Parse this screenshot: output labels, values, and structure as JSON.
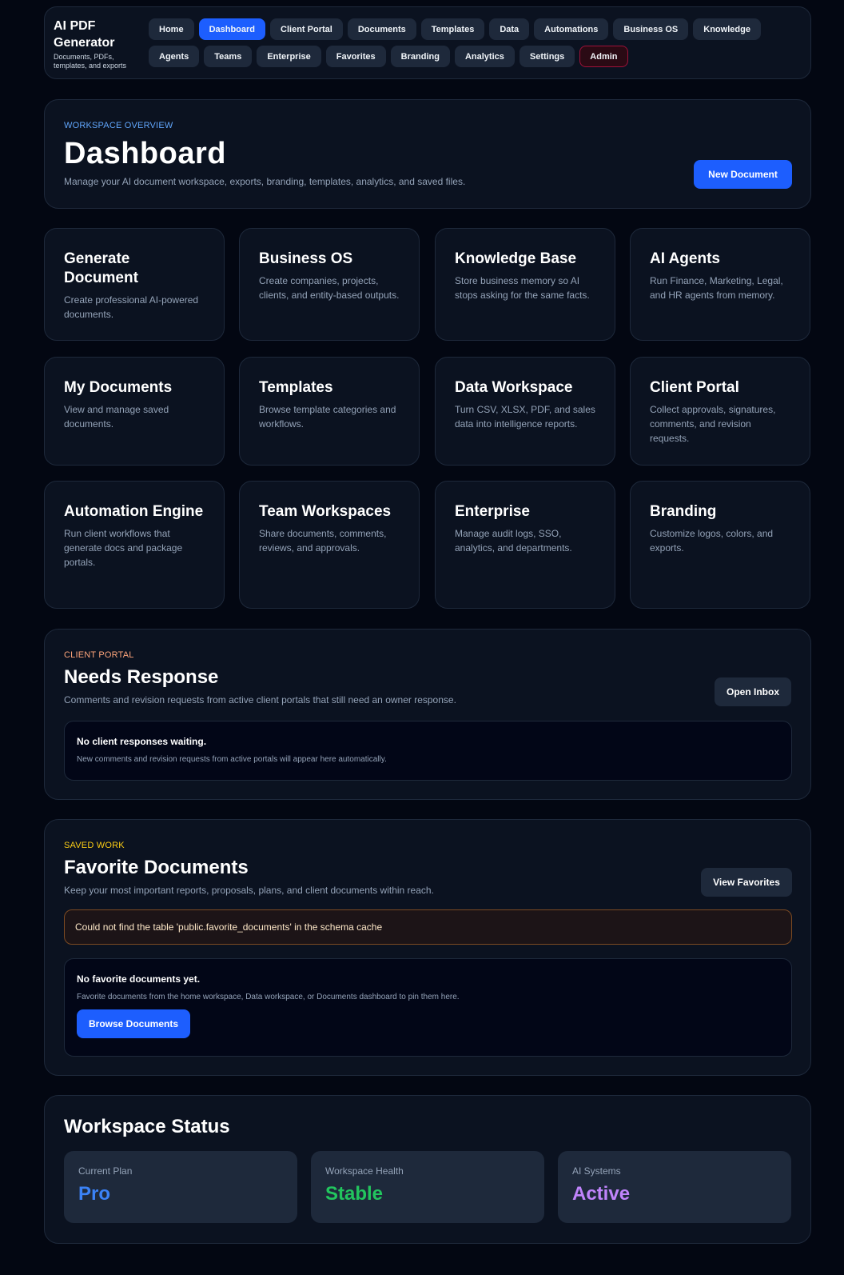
{
  "brand": {
    "title": "AI PDF Generator",
    "subtitle": "Documents, PDFs, templates, and exports"
  },
  "nav": {
    "items": [
      "Home",
      "Dashboard",
      "Client Portal",
      "Documents",
      "Templates",
      "Data",
      "Automations",
      "Business OS",
      "Knowledge",
      "Agents",
      "Teams",
      "Enterprise",
      "Favorites",
      "Branding",
      "Analytics",
      "Settings",
      "Admin"
    ],
    "active": "Dashboard"
  },
  "overview": {
    "eyebrow": "WORKSPACE OVERVIEW",
    "title": "Dashboard",
    "description": "Manage your AI document workspace, exports, branding, templates, analytics, and saved files.",
    "new_button": "New Document"
  },
  "tiles": [
    {
      "title": "Generate Document",
      "desc": "Create professional AI-powered documents."
    },
    {
      "title": "Business OS",
      "desc": "Create companies, projects, clients, and entity-based outputs."
    },
    {
      "title": "Knowledge Base",
      "desc": "Store business memory so AI stops asking for the same facts."
    },
    {
      "title": "AI Agents",
      "desc": "Run Finance, Marketing, Legal, and HR agents from memory."
    },
    {
      "title": "My Documents",
      "desc": "View and manage saved documents."
    },
    {
      "title": "Templates",
      "desc": "Browse template categories and workflows."
    },
    {
      "title": "Data Workspace",
      "desc": "Turn CSV, XLSX, PDF, and sales data into intelligence reports."
    },
    {
      "title": "Client Portal",
      "desc": "Collect approvals, signatures, comments, and revision requests."
    },
    {
      "title": "Automation Engine",
      "desc": "Run client workflows that generate docs and package portals."
    },
    {
      "title": "Team Workspaces",
      "desc": "Share documents, comments, reviews, and approvals."
    },
    {
      "title": "Enterprise",
      "desc": "Manage audit logs, SSO, analytics, and departments."
    },
    {
      "title": "Branding",
      "desc": "Customize logos, colors, and exports."
    }
  ],
  "portal": {
    "eyebrow": "CLIENT PORTAL",
    "title": "Needs Response",
    "description": "Comments and revision requests from active client portals that still need an owner response.",
    "button": "Open Inbox",
    "empty_title": "No client responses waiting.",
    "empty_desc": "New comments and revision requests from active portals will appear here automatically."
  },
  "favorites": {
    "eyebrow": "SAVED WORK",
    "title": "Favorite Documents",
    "description": "Keep your most important reports, proposals, plans, and client documents within reach.",
    "button": "View Favorites",
    "error": "Could not find the table 'public.favorite_documents' in the schema cache",
    "empty_title": "No favorite documents yet.",
    "empty_desc": "Favorite documents from the home workspace, Data workspace, or Documents dashboard to pin them here.",
    "browse_button": "Browse Documents"
  },
  "status": {
    "title": "Workspace Status",
    "cards": [
      {
        "label": "Current Plan",
        "value": "Pro",
        "color": "#3b82f6"
      },
      {
        "label": "Workspace Health",
        "value": "Stable",
        "color": "#22c55e"
      },
      {
        "label": "AI Systems",
        "value": "Active",
        "color": "#c084fc"
      }
    ]
  },
  "colors": {
    "background": "#030712",
    "panel": "#0b1220",
    "accent": "#1d5efe",
    "muted_text": "#94a3b8"
  }
}
